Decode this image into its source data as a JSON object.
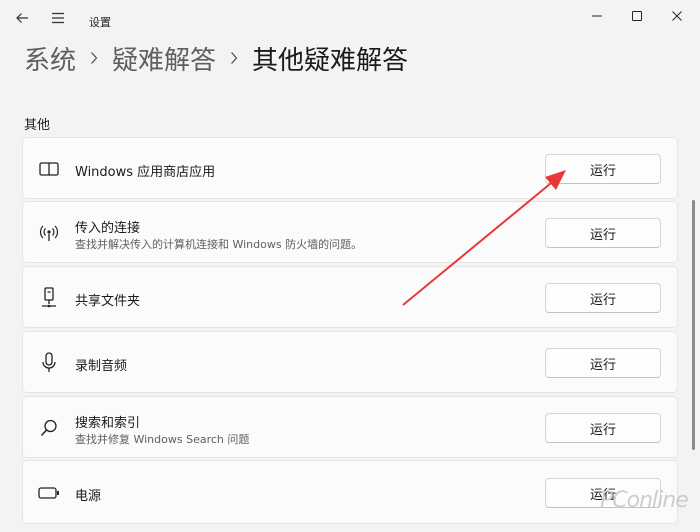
{
  "window": {
    "title": "设置",
    "controls": {
      "minimize_icon": "minimize-icon",
      "maximize_icon": "maximize-icon",
      "close_icon": "close-icon"
    }
  },
  "breadcrumb": [
    "系统",
    "疑难解答",
    "其他疑难解答"
  ],
  "section_label": "其他",
  "items": [
    {
      "icon": "store-app-icon",
      "title": "Windows 应用商店应用",
      "desc": "",
      "button": "运行"
    },
    {
      "icon": "wireless-signal-icon",
      "title": "传入的连接",
      "desc": "查找并解决传入的计算机连接和 Windows 防火墙的问题。",
      "button": "运行"
    },
    {
      "icon": "network-share-icon",
      "title": "共享文件夹",
      "desc": "",
      "button": "运行"
    },
    {
      "icon": "microphone-icon",
      "title": "录制音频",
      "desc": "",
      "button": "运行"
    },
    {
      "icon": "search-icon",
      "title": "搜索和索引",
      "desc": "查找并修复 Windows Search 问题",
      "button": "运行"
    },
    {
      "icon": "battery-icon",
      "title": "电源",
      "desc": "",
      "button": "运行"
    }
  ],
  "annotation_color": "#e8393a",
  "watermark": "PConline"
}
